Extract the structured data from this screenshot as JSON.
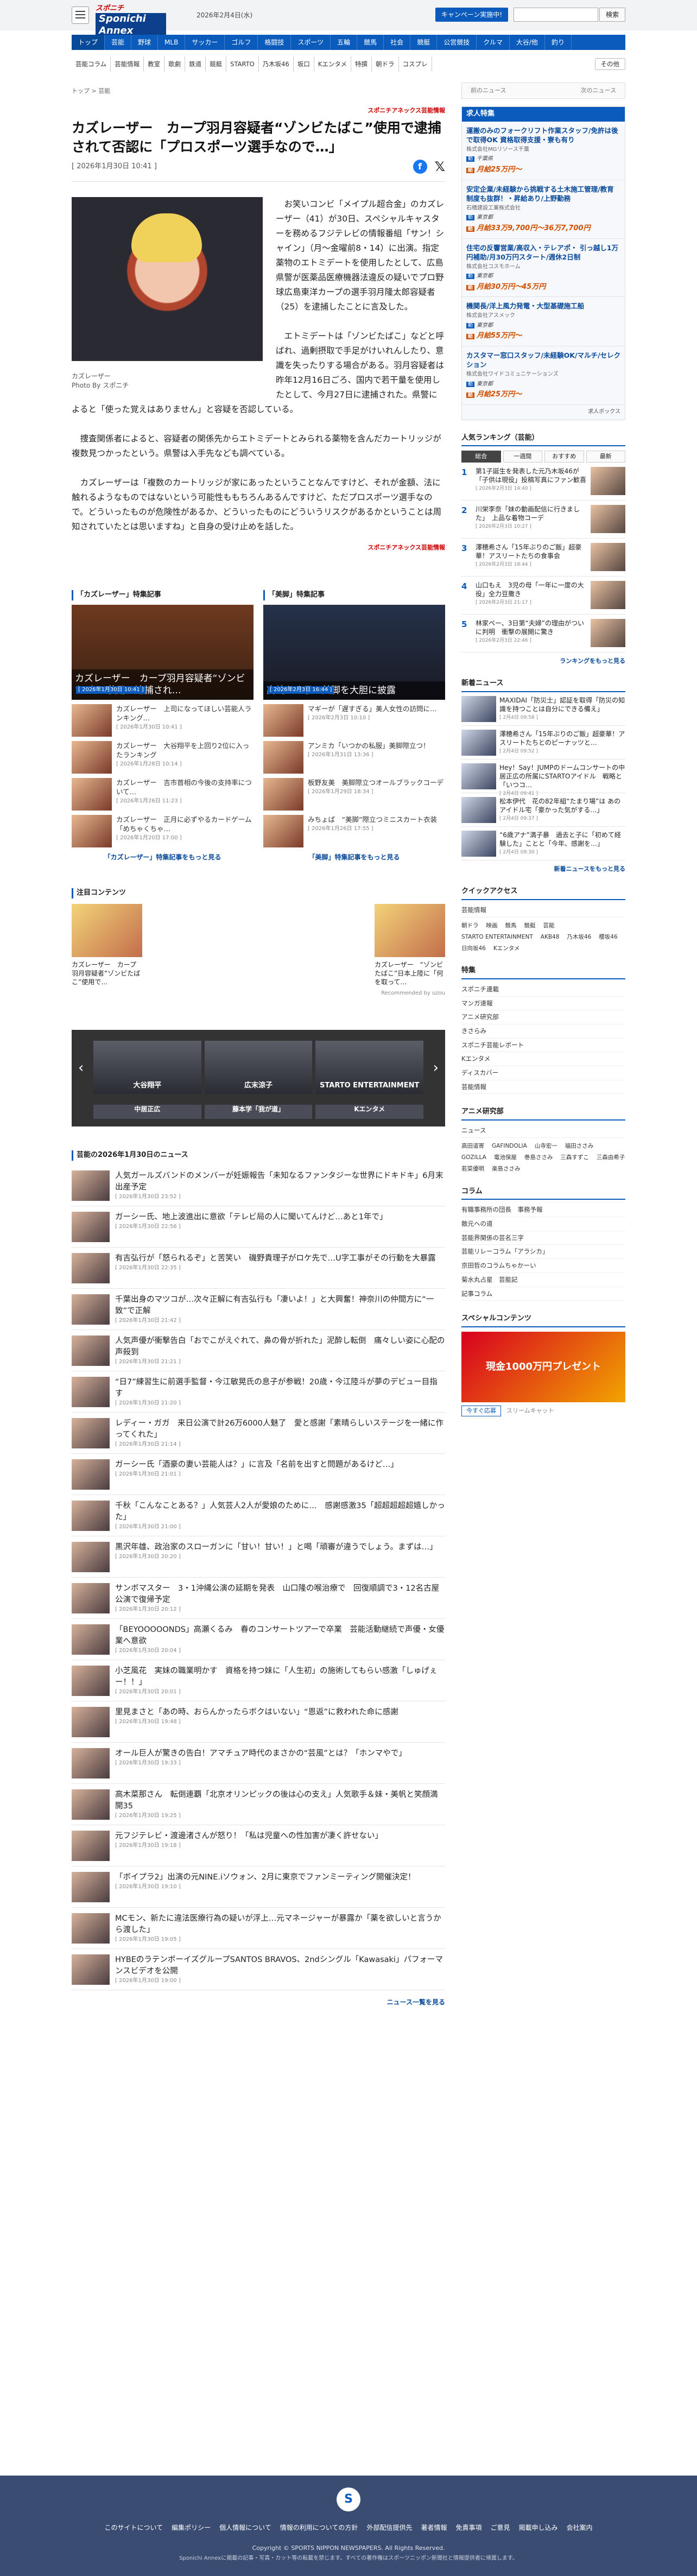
{
  "header": {
    "logo_top": "スポニチ",
    "logo_bottom": "Sponichi Annex",
    "date": "2026年2月4日(水)",
    "campaign_button": "キャンペーン実施中!",
    "search_placeholder": "",
    "search_button": "検索"
  },
  "nav": [
    "トップ",
    "芸能",
    "野球",
    "MLB",
    "サッカー",
    "ゴルフ",
    "格闘技",
    "スポーツ",
    "五輪",
    "競馬",
    "社会",
    "競艇",
    "公営競技",
    "クルマ",
    "大谷/他",
    "釣り"
  ],
  "subnav": [
    "芸能コラム",
    "芸能情報",
    "教室",
    "歌劇",
    "鉄道",
    "競艇",
    "STARTO",
    "乃木坂46",
    "坂口",
    "Kエンタメ",
    "特撰",
    "朝ドラ",
    "コスプレ"
  ],
  "subnav_more": "その他",
  "breadcrumb": "トップ > 芸能",
  "pager": {
    "prev": "前のニュース",
    "next": "次のニュース"
  },
  "article": {
    "source": "スポニチアネックス芸能情報",
    "title": "カズレーザー　カープ羽月容疑者“ゾンビたばこ”使用で逮捕されて否認に「プロスポーツ選手なので…」",
    "date": "[ 2026年1月30日 10:41 ]",
    "caption1": "カズレーザー",
    "caption2": "Photo By スポニチ",
    "paragraphs": [
      "お笑いコンビ「メイプル超合金」のカズレーザー（41）が30日、スペシャルキャスターを務めるフジテレビの情報番組「サン！シャイン」（月～金曜前8・14）に出演。指定薬物のエトミデートを使用したとして、広島県警が医薬品医療機器法違反の疑いでプロ野球広島東洋カープの選手羽月隆太郎容疑者（25）を逮捕したことに言及した。",
      "エトミデートは「ゾンビたばこ」などと呼ばれ、過剰摂取で手足がけいれんしたり、意識を失ったりする場合がある。羽月容疑者は昨年12月16日ごろ、国内で若干量を使用したとして、今月27日に逮捕された。県警によると「使った覚えはありません」と容疑を否認している。",
      "捜査関係者によると、容疑者の関係先からエトミデートとみられる薬物を含んだカートリッジが複数見つかったという。県警は入手先なども調べている。",
      "カズレーザーは「複数のカートリッジが家にあったということなんですけど、それが金額、法に触れるようなものではないという可能性ももちろんあるんですけど、ただプロスポーツ選手なので。どういったものが危険性があるか、どういったものにどういうリスクがあるかということは周知されていたとは思いますね」と自身の受け止めを話した。"
    ],
    "source_bottom": "スポニチアネックス芸能情報"
  },
  "features": {
    "left_title": "「カズレーザー」特集記事",
    "left_big": "カズレーザー　カープ羽月容疑者“ゾンビたばこ”使用で逮捕され…",
    "left_big_date": "[ 2026年1月30日 10:41 ]",
    "left_items": [
      {
        "t": "カズレーザー　上司になってほしい芸能人ランキング…",
        "d": "[ 2026年1月30日 10:41 ]"
      },
      {
        "t": "カズレーザー　大谷翔平を上回り2位に入ったランキング",
        "d": "[ 2026年1月28日 10:14 ]"
      },
      {
        "t": "カズレーザー　吉市首相の今後の支持率について…",
        "d": "[ 2026年1月26日 11:23 ]"
      },
      {
        "t": "カズレーザー　正月に必ずやるカードゲーム「めちゃくちゃ…",
        "d": "[ 2026年1月20日 17:00 ]"
      }
    ],
    "left_more": "「カズレーザー」特集記事をもっと見る",
    "right_title": "「美脚」特集記事",
    "right_big": "高嶋ちさ子　美脚を大胆に披露",
    "right_big_date": "[ 2026年2月3日 16:44 ]",
    "right_items": [
      {
        "t": "マギーが「遅すぎる」美人女性の訪問に…",
        "d": "[ 2026年2月3日 10:10 ]"
      },
      {
        "t": "アンミカ「いつかの私服」美脚際立つ！",
        "d": "[ 2026年1月31日 13:36 ]"
      },
      {
        "t": "板野友美　美脚際立つオールブラックコーデ",
        "d": "[ 2026年1月29日 18:34 ]"
      },
      {
        "t": "みちょぱ　“美脚”際立つミニスカート衣装",
        "d": "[ 2026年1月26日 17:55 ]"
      }
    ],
    "right_more": "「美脚」特集記事をもっと見る"
  },
  "recommend": {
    "title": "注目コンテンツ",
    "items": [
      {
        "t": "カズレーザー　カープ羽月容疑者“ゾンビたばこ”使用で…"
      },
      {
        "t": "カズレーザー　“ゾンビたばこ”日本上陸に「何を取って…"
      }
    ],
    "powered": "Recommended by uzou"
  },
  "banner": [
    "大谷翔平",
    "広末涼子",
    "STARTO ENTERTAINMENT",
    "中居正広",
    "藤本学「我が道」",
    "Kエンタメ"
  ],
  "newslist": {
    "title": "芸能の2026年1月30日のニュース",
    "items": [
      {
        "t": "人気ガールズバンドのメンバーが妊娠報告「未知なるファンタジーな世界にドキドキ」6月末出産予定",
        "d": "[ 2026年1月30日 23:52 ]"
      },
      {
        "t": "ガーシー氏、地上波進出に意欲「テレビ局の人に聞いてんけど…あと1年で」",
        "d": "[ 2026年1月30日 22:56 ]"
      },
      {
        "t": "有吉弘行が「怒られるぞ」と苦笑い　磯野貴理子がロケ先で…U字工事がその行動を大暴露",
        "d": "[ 2026年1月30日 22:35 ]"
      },
      {
        "t": "千葉出身のマツコが…次々正解に有吉弘行も「凄いよ！」と大興奮！神奈川の仲間方に“一致”で正解",
        "d": "[ 2026年1月30日 21:42 ]"
      },
      {
        "t": "人気声優が衝撃告白「おでこがえぐれて、鼻の骨が折れた」泥酔し転倒　痛々しい姿に心配の声殺到",
        "d": "[ 2026年1月30日 21:21 ]"
      },
      {
        "t": "“日7”練習生に前選手監督・今江敏晃氏の息子が参戦！20歳・今江陸斗が夢のデビュー目指す",
        "d": "[ 2026年1月30日 21:20 ]"
      },
      {
        "t": "レディー・ガガ　来日公演で計26万6000人魅了　愛と感謝「素晴らしいステージを一緒に作ってくれた」",
        "d": "[ 2026年1月30日 21:14 ]"
      },
      {
        "t": "ガーシー氏「酒豪の妻い芸能人は？」に言及「名前を出すと問題があるけど…」",
        "d": "[ 2026年1月30日 21:01 ]"
      },
      {
        "t": "千秋「こんなことある？」人気芸人2人が愛娘のために…　感謝感激35「超超超超超嬉しかった」",
        "d": "[ 2026年1月30日 21:00 ]"
      },
      {
        "t": "黒沢年雄、政治家のスローガンに「甘い！甘い！」と喝「頑審が違うでしょう。まずは…」",
        "d": "[ 2026年1月30日 20:20 ]"
      },
      {
        "t": "サンボマスター　3・1沖縄公演の延期を発表　山口隆の喉治療で　回復順調で3・12名古屋公演で復帰予定",
        "d": "[ 2026年1月30日 20:12 ]"
      },
      {
        "t": "「BEYOOOOONDS」高瀬くるみ　春のコンサートツアーで卒業　芸能活動継続で声優・女優業へ意欲",
        "d": "[ 2026年1月30日 20:04 ]"
      },
      {
        "t": "小芝風花　実妹の職業明かす　資格を持つ妹に「人生初」の施術してもらい感激「しゅげぇー！！」",
        "d": "[ 2026年1月30日 20:01 ]"
      },
      {
        "t": "里見まさと「あの時、おらんかったらボクはいない」“恩返”に救われた命に感謝",
        "d": "[ 2026年1月30日 19:48 ]"
      },
      {
        "t": "オール巨人が驚きの告白！アマチュア時代のまさかの“芸風”とは？「ホンマやで」",
        "d": "[ 2026年1月30日 19:33 ]"
      },
      {
        "t": "高木菜那さん　転倒連覇「北京オリンピックの後は心の支え」人気歌手＆妹・美帆と笑顔満開35",
        "d": "[ 2026年1月30日 19:25 ]"
      },
      {
        "t": "元フジテレビ・渡邊渚さんが怒り！「私は児童への性加害が凄く許せない」",
        "d": "[ 2026年1月30日 19:18 ]"
      },
      {
        "t": "「ボイプラ2」出演の元NINE.iソウォン、2月に東京でファンミーティング開催決定！",
        "d": "[ 2026年1月30日 19:10 ]"
      },
      {
        "t": "MCモン、新たに違法医療行為の疑いが浮上…元マネージャーが暴露か「薬を欲しいと言うから渡した」",
        "d": "[ 2026年1月30日 19:05 ]"
      },
      {
        "t": "HYBEのラテンボーイズグループSANTOS BRAVOS、2ndシングル「Kawasaki」パフォーマンスビデオを公開",
        "d": "[ 2026年1月30日 19:00 ]"
      }
    ],
    "more": "ニュース一覧を見る"
  },
  "side": {
    "jobs_title": "求人特集",
    "jobs": [
      {
        "t": "運搬のみのフォークリフト作業スタッフ/免許は後で取得OK 資格取得支援・寮も有り",
        "c": "株式会社MGリソース千葉",
        "l": "千葉県",
        "p": "月給25万円〜"
      },
      {
        "t": "安定企業/未経験から挑戦する土木施工管理/教育制度も抜群！・昇給あり/上野勤務",
        "c": "石橋建設工業株式会社",
        "l": "東京都",
        "p": "月給33万9,700円〜36万7,700円"
      },
      {
        "t": "住宅の反響営業/高収入・テレアポ・ 引っ越し1万円補助/月30万円スタート/週休2日制",
        "c": "株式会社コスモホーム",
        "l": "東京都",
        "p": "月給30万円〜45万円"
      },
      {
        "t": "機関長/洋上風力発電・大型基礎施工船",
        "c": "株式会社アスメック",
        "l": "東京都",
        "p": "月給55万円〜"
      },
      {
        "t": "カスタマー窓口スタッフ/未経験OK/マルチ/セレクション",
        "c": "株式会社ワイドコミュニケーションズ",
        "l": "東京都",
        "p": "月給25万円〜"
      }
    ],
    "jobs_foot": "求人ボックス",
    "ranking_title": "人気ランキング（芸能）",
    "ranking_tabs": [
      "総合",
      "一週間",
      "おすすめ",
      "最新"
    ],
    "ranking": [
      {
        "t": "第1子誕生を発表した元乃木坂46が「子供は現役」投稿写真にファン歓喜",
        "d": "[ 2026年2月3日 14:40 ]"
      },
      {
        "t": "川栄李奈「妹の動画配信に行きました」　上品な着物コーデ",
        "d": "[ 2026年2月3日 10:27 ]"
      },
      {
        "t": "澤穂希さん「15年ぶりのご飯」超豪華！アスリートたちの食事会",
        "d": "[ 2026年2月3日 18:44 ]"
      },
      {
        "t": "山口もえ　3児の母「一年に一度の大役」全力豆撒き",
        "d": "[ 2026年2月3日 21:17 ]"
      },
      {
        "t": "林家ペー、3日第“夫婦”の理由がついに判明　衝撃の展開に驚き",
        "d": "[ 2026年2月3日 22:46 ]"
      }
    ],
    "ranking_more": "ランキングをもっと見る",
    "news_title": "新着ニュース",
    "news": [
      {
        "t": "MAXIDAI「防災士」認証を取得「防災の知識を持つことは自分にできる備え」",
        "d": "[ 2月4日 09:58 ]"
      },
      {
        "t": "澤穂希さん「15年ぶりのご飯」超豪華！アスリートたちとのピーナッツと…",
        "d": "[ 2月4日 09:52 ]"
      },
      {
        "t": "Hey！Say！JUMPのドームコンサートの中居正広の所属にSTARTOアイドル　戦略と「いつコ…",
        "d": "[ 2月4日 09:41 ]"
      },
      {
        "t": "松本伊代　花の82年組“たまり場”は あのアイドル宅「豪かった気がする…」",
        "d": "[ 2月4日 09:37 ]"
      },
      {
        "t": "“6歳アナ”満子暴　過去と子に「初めて経験した」ことと「今年、感謝を…」",
        "d": "[ 2月4日 09:30 ]"
      }
    ],
    "news_more": "新着ニュースをもっと見る",
    "quick_title": "クイックアクセス",
    "quick_top": "芸能情報",
    "quick_tags": [
      "朝ドラ",
      "映画",
      "競馬",
      "競艇",
      "芸能",
      "STARTO ENTERTAINMENT",
      "AKB48",
      "乃木坂46",
      "櫻坂46",
      "日向坂46",
      "Kエンタメ"
    ],
    "special_title": "特集",
    "special_links": [
      "スポニチ連載",
      "マンガ速報",
      "アニメ研究部",
      "きさらみ",
      "スポニチ芸能レポート",
      "Kエンタメ",
      "ディスカバー",
      "芸能情報"
    ],
    "anime_title": "アニメ研究部",
    "anime_link": "ニュース",
    "anime_tags": [
      "高田道寄",
      "GAFINDOLIA",
      "山寺宏一",
      "福田ささみ",
      "GOZILLA",
      "電池保屋",
      "巻島ささみ",
      "三森すずこ",
      "三森由希子",
      "若菜優明",
      "楽島ささみ"
    ],
    "column_title": "コラム",
    "column_links": [
      "有職事務所の団長　事務予報",
      "散元への道",
      "芸能界関係の芸名三字",
      "芸能リレーコラム「アラシカ」",
      "京田哲のコラムちゃかーい",
      "菊水丸占星　芸能記",
      "記事コラム"
    ],
    "sp_title": "スペシャルコンテンツ",
    "sp_banner": "現金1000万円プレゼント",
    "sp_btn": "今すぐ応募",
    "sp_sub": "スリームキャット"
  },
  "footer": {
    "logo": "S",
    "links": [
      "このサイトについて",
      "編集ポリシー",
      "個人情報について",
      "情報の利用についての方針",
      "外部配信提供先",
      "著者情報",
      "免責事項",
      "ご意見",
      "掲載申し込み",
      "会社案内"
    ],
    "copyright": "Copyright © SPORTS NIPPON NEWSPAPERS. All Rights Reserved.",
    "note": "Sponichi Annexに掲載の記事・写真・カット等の転載を禁じます。すべての著作権はスポーツニッポン新聞社と情報提供者に帰属します。"
  }
}
